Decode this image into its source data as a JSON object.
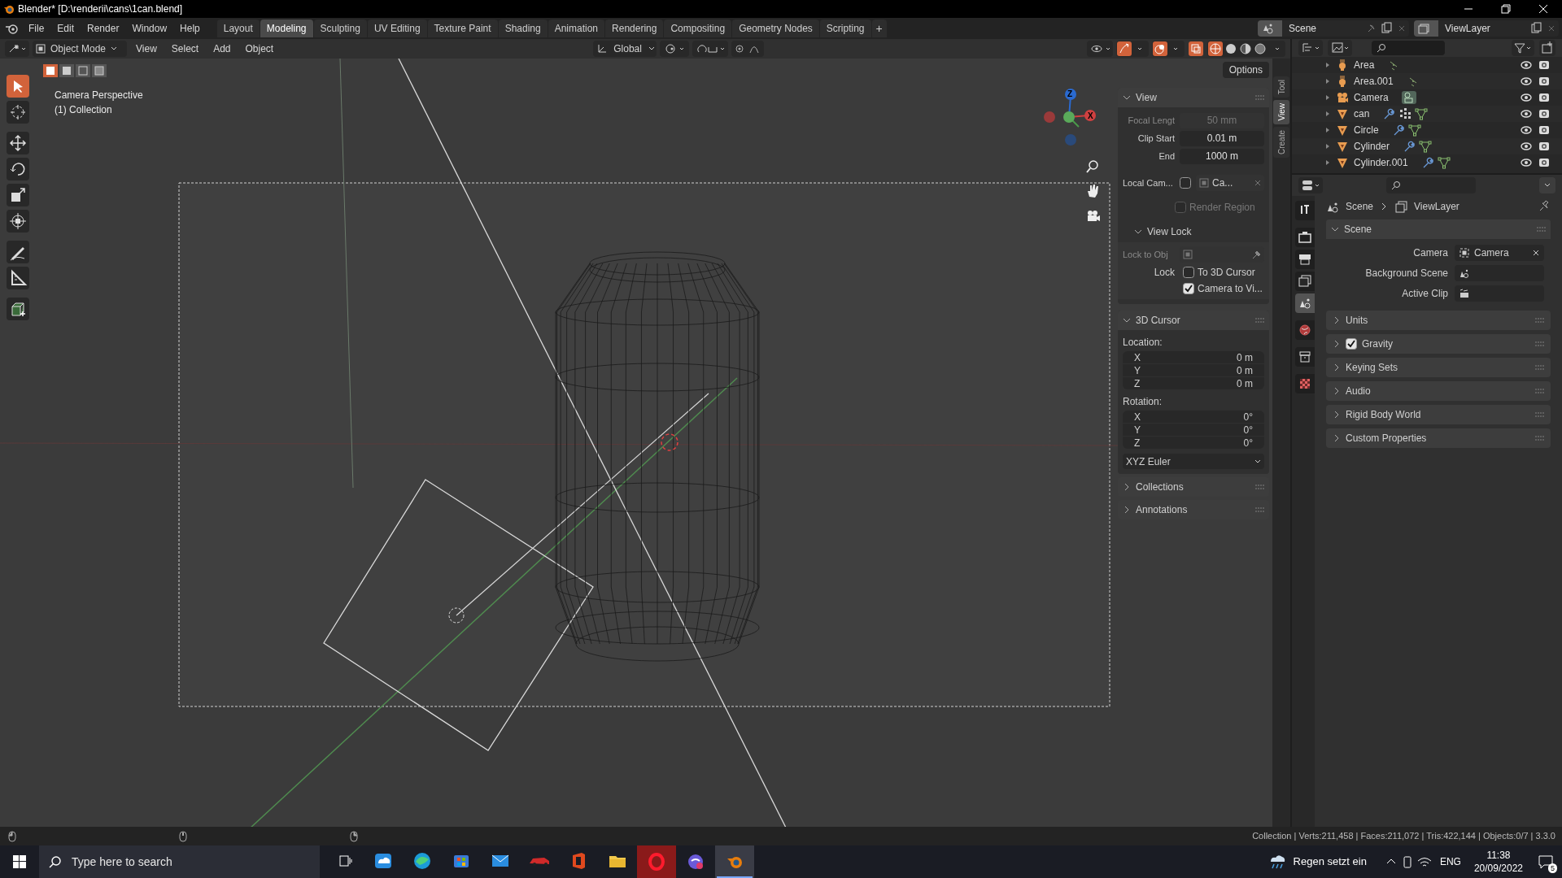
{
  "title_bar": {
    "title": "Blender* [D:\\renderii\\cans\\1can.blend]"
  },
  "menus": [
    "File",
    "Edit",
    "Render",
    "Window",
    "Help"
  ],
  "workspaces": [
    {
      "label": "Layout",
      "selected": false
    },
    {
      "label": "Modeling",
      "selected": true
    },
    {
      "label": "Sculpting",
      "selected": false
    },
    {
      "label": "UV Editing",
      "selected": false
    },
    {
      "label": "Texture Paint",
      "selected": false
    },
    {
      "label": "Shading",
      "selected": false
    },
    {
      "label": "Animation",
      "selected": false
    },
    {
      "label": "Rendering",
      "selected": false
    },
    {
      "label": "Compositing",
      "selected": false
    },
    {
      "label": "Geometry Nodes",
      "selected": false
    },
    {
      "label": "Scripting",
      "selected": false
    }
  ],
  "add_workspace": "+",
  "scene_selector": {
    "scene": "Scene",
    "view_layer": "ViewLayer"
  },
  "header": {
    "mode": "Object Mode",
    "menus": [
      "View",
      "Select",
      "Add",
      "Object"
    ],
    "orientation": "Global"
  },
  "viewport": {
    "camera_label": "Camera Perspective",
    "collection_label": "(1) Collection",
    "options": "Options",
    "tools": [
      {
        "kind": "select",
        "selected": true
      },
      {
        "kind": "cursor",
        "selected": false
      },
      {
        "kind": "move",
        "selected": false
      },
      {
        "kind": "rotate",
        "selected": false
      },
      {
        "kind": "scale",
        "selected": false
      },
      {
        "kind": "transform",
        "selected": false
      },
      {
        "kind": "annotate",
        "selected": false
      },
      {
        "kind": "measure",
        "selected": false
      },
      {
        "kind": "add",
        "selected": false
      }
    ],
    "gizmo_axes": [
      "Z",
      "X"
    ]
  },
  "sidebar_tabs": [
    {
      "label": "Tool",
      "selected": false
    },
    {
      "label": "View",
      "selected": true
    },
    {
      "label": "Create",
      "selected": false
    }
  ],
  "view_panel": {
    "title": "View",
    "fields": [
      {
        "label": "Focal Lengt",
        "value": "50 mm",
        "disabled": true
      },
      {
        "label": "Clip Start",
        "value": "0.01 m",
        "disabled": false
      },
      {
        "label": "End",
        "value": "1000 m",
        "disabled": false
      }
    ],
    "local_camera": {
      "label": "Local Cam...",
      "checked": false,
      "value": "Ca..."
    },
    "render_region": {
      "label": "Render Region",
      "checked": false
    },
    "view_lock": {
      "title": "View Lock",
      "lock_to_obj": "Lock to Obj",
      "lock_label": "Lock",
      "options": [
        {
          "label": "To 3D Cursor",
          "checked": false
        },
        {
          "label": "Camera to Vi...",
          "checked": true
        }
      ]
    }
  },
  "cursor_panel": {
    "title": "3D Cursor",
    "location_label": "Location:",
    "location": [
      {
        "axis": "X",
        "value": "0 m"
      },
      {
        "axis": "Y",
        "value": "0 m"
      },
      {
        "axis": "Z",
        "value": "0 m"
      }
    ],
    "rotation_label": "Rotation:",
    "rotation": [
      {
        "axis": "X",
        "value": "0°"
      },
      {
        "axis": "Y",
        "value": "0°"
      },
      {
        "axis": "Z",
        "value": "0°"
      }
    ],
    "rotation_mode": "XYZ Euler"
  },
  "sidebar_collapsed": [
    "Collections",
    "Annotations"
  ],
  "outliner": {
    "rows": [
      {
        "name": "Area",
        "kind": "light",
        "modifier": false,
        "particles": false
      },
      {
        "name": "Area.001",
        "kind": "light",
        "modifier": false,
        "particles": false
      },
      {
        "name": "Camera",
        "kind": "camera",
        "modifier": false,
        "particles": false
      },
      {
        "name": "can",
        "kind": "mesh",
        "modifier": true,
        "particles": true
      },
      {
        "name": "Circle",
        "kind": "mesh",
        "modifier": true,
        "particles": false
      },
      {
        "name": "Cylinder",
        "kind": "mesh",
        "modifier": true,
        "particles": false
      },
      {
        "name": "Cylinder.001",
        "kind": "mesh",
        "modifier": true,
        "particles": false
      }
    ]
  },
  "properties": {
    "tabs": [
      {
        "kind": "tool",
        "selected": false
      },
      {
        "kind": "render",
        "selected": false
      },
      {
        "kind": "output",
        "selected": false
      },
      {
        "kind": "view_layer",
        "selected": false
      },
      {
        "kind": "scene",
        "selected": true
      },
      {
        "kind": "world",
        "selected": false
      },
      {
        "kind": "collection",
        "selected": false
      },
      {
        "kind": "texture",
        "selected": false
      }
    ],
    "breadcrumb": [
      "Scene",
      "ViewLayer"
    ],
    "scene_panel": {
      "title": "Scene",
      "fields": [
        {
          "label": "Camera",
          "kind": "object",
          "value": "Camera"
        },
        {
          "label": "Background Scene",
          "kind": "scene"
        },
        {
          "label": "Active Clip",
          "kind": "clip"
        }
      ]
    },
    "panels": [
      {
        "title": "Units",
        "kind": "plain"
      },
      {
        "title": "Gravity",
        "kind": "checkbox",
        "checked": true
      },
      {
        "title": "Keying Sets",
        "kind": "plain"
      },
      {
        "title": "Audio",
        "kind": "plain"
      },
      {
        "title": "Rigid Body World",
        "kind": "plain"
      },
      {
        "title": "Custom Properties",
        "kind": "plain"
      }
    ]
  },
  "status_bar": "Collection | Verts:211,458 | Faces:211,072 | Tris:422,144 | Objects:0/7 | 3.3.0",
  "taskbar": {
    "search_placeholder": "Type here to search",
    "apps": [
      {
        "kind": "task_view",
        "active": false
      },
      {
        "kind": "cloud",
        "active": false
      },
      {
        "kind": "edge",
        "active": false
      },
      {
        "kind": "store",
        "active": false
      },
      {
        "kind": "mail",
        "active": false
      },
      {
        "kind": "car",
        "active": false
      },
      {
        "kind": "office",
        "active": false
      },
      {
        "kind": "folder",
        "active": false
      },
      {
        "kind": "opera",
        "active": false
      },
      {
        "kind": "chat",
        "active": false
      },
      {
        "kind": "blender",
        "active": true
      }
    ],
    "weather": "Regen setzt ein",
    "language": "ENG",
    "time": "11:38",
    "date": "20/09/2022",
    "notifications": "5"
  }
}
